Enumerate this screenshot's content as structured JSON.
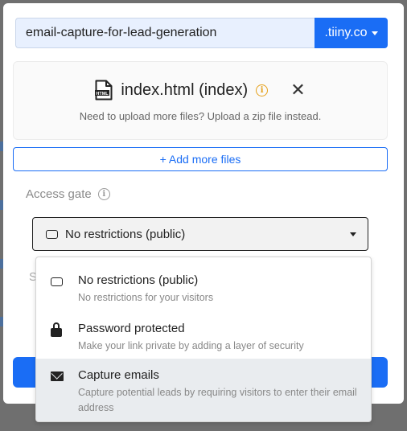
{
  "upload": {
    "subdomain_value": "email-capture-for-lead-generation",
    "domain_label": ".tiiny.co"
  },
  "file": {
    "name": "index.html (index)",
    "icon_tag": "HTML",
    "hint": "Need to upload more files? Upload a zip file instead."
  },
  "add_more_label": "+ Add more files",
  "access": {
    "label": "Access gate",
    "selected": "No restrictions (public)",
    "options": [
      {
        "icon": "rectangle-icon",
        "title": "No restrictions (public)",
        "desc": "No restrictions for your visitors"
      },
      {
        "icon": "lock-icon",
        "title": "Password protected",
        "desc": "Make your link private by adding a layer of security"
      },
      {
        "icon": "envelope-icon",
        "title": "Capture emails",
        "desc": "Capture potential leads by requiring visitors to enter their email address"
      }
    ]
  },
  "peek": {
    "s_letter": "S"
  },
  "colors": {
    "primary": "#1a6df5",
    "input_bg": "#e8f0fe",
    "info_orange": "#e5a019",
    "hover_bg": "#e9ecef",
    "overlay": "#6f6f6f"
  }
}
